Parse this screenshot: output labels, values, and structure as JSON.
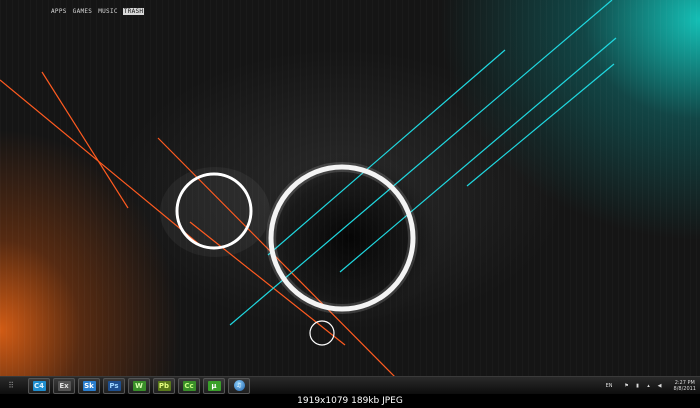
{
  "menu": {
    "items": [
      {
        "label": "APPS",
        "active": false
      },
      {
        "label": "GAMES",
        "active": false
      },
      {
        "label": "MUSIC",
        "active": false
      },
      {
        "label": "TRASH",
        "active": true
      }
    ]
  },
  "wallpaper": {
    "accent_orange": "#ff5a1f",
    "accent_teal": "#1fd8e0"
  },
  "taskbar": {
    "apps": [
      {
        "label": "C4",
        "color": "#1f8fd0",
        "fg": "#dff4ff"
      },
      {
        "label": "Ex",
        "color": "#555555",
        "fg": "#e0e0e0"
      },
      {
        "label": "Sk",
        "color": "#2a7fd0",
        "fg": "#ffffff"
      },
      {
        "label": "Ps",
        "color": "#1e4f8f",
        "fg": "#9fd6ff"
      },
      {
        "label": "W",
        "color": "#3a8f2a",
        "fg": "#d8ffb0"
      },
      {
        "label": "Pb",
        "color": "#5a7a1a",
        "fg": "#e8ff80"
      },
      {
        "label": "Cc",
        "color": "#3a8f2a",
        "fg": "#c8ff80"
      },
      {
        "label": "μ",
        "color": "#3aa02a",
        "fg": "#ffffff"
      },
      {
        "label": "♫",
        "color": "#1e5fa8",
        "fg": "#ffffff"
      }
    ],
    "tray": {
      "language": "EN",
      "icons": [
        "flag-icon",
        "network-icon",
        "signal-icon",
        "volume-icon"
      ],
      "time": "2:27 PM",
      "date": "8/8/2011"
    }
  },
  "footer": {
    "info": "1919x1079  189kb  JPEG"
  }
}
